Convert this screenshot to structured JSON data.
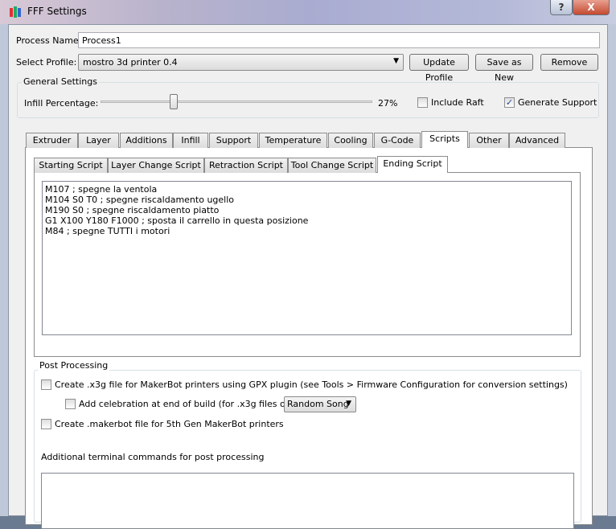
{
  "window": {
    "title": "FFF Settings",
    "help": "?",
    "close": "X"
  },
  "process_name": {
    "label": "Process Name:",
    "value": "Process1"
  },
  "profile": {
    "label": "Select Profile:",
    "value": "mostro 3d printer 0.4",
    "update": "Update Profile",
    "save_new": "Save as New",
    "remove": "Remove"
  },
  "general": {
    "title": "General Settings",
    "infill_label": "Infill Percentage:",
    "infill_value": 27,
    "infill_text": "27%",
    "raft": "Include Raft",
    "raft_checked": false,
    "support": "Generate Support",
    "support_checked": true
  },
  "tabs": [
    "Extruder",
    "Layer",
    "Additions",
    "Infill",
    "Support",
    "Temperature",
    "Cooling",
    "G-Code",
    "Scripts",
    "Other",
    "Advanced"
  ],
  "active_tab": "Scripts",
  "script_tabs": [
    "Starting Script",
    "Layer Change Script",
    "Retraction Script",
    "Tool Change Script",
    "Ending Script"
  ],
  "active_script_tab": "Ending Script",
  "script_text": "M107 ; spegne la ventola\nM104 S0 T0 ; spegne riscaldamento ugello\nM190 S0 ; spegne riscaldamento piatto\nG1 X100 Y180 F1000 ; sposta il carrello in questa posizione\nM84 ; spegne TUTTI i motori",
  "post": {
    "title": "Post Processing",
    "x3g": "Create .x3g file for MakerBot printers using GPX plugin (see Tools > Firmware Configuration for conversion settings)",
    "celebration": "Add celebration at end of build (for .x3g files only)",
    "song": "Random Song",
    "makerbot": "Create .makerbot file for 5th Gen MakerBot printers",
    "terminal_label": "Additional terminal commands for post processing",
    "terminal_value": ""
  }
}
